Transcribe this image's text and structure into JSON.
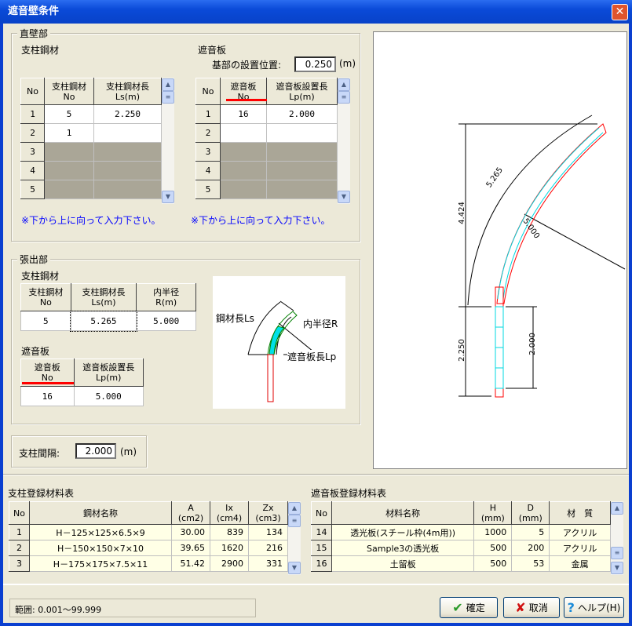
{
  "window": {
    "title": "遮音壁条件",
    "close": "✕"
  },
  "straight": {
    "legend": "直壁部",
    "post": {
      "label": "支柱鋼材",
      "headers": [
        "No",
        "支柱鋼材\nNo",
        "支柱鋼材長\nLs(m)"
      ],
      "rows": [
        [
          "1",
          "5",
          "2.250"
        ],
        [
          "2",
          "1",
          ""
        ],
        [
          "3",
          "",
          ""
        ],
        [
          "4",
          "",
          ""
        ],
        [
          "5",
          "",
          ""
        ]
      ]
    },
    "panel": {
      "label": "遮音板",
      "base_label": "基部の設置位置:",
      "base_value": "0.250",
      "base_unit": "(m)",
      "headers": [
        "No",
        "遮音板\nNo",
        "遮音板設置長\nLp(m)"
      ],
      "rows": [
        [
          "1",
          "16",
          "2.000"
        ],
        [
          "2",
          "",
          ""
        ],
        [
          "3",
          "",
          ""
        ],
        [
          "4",
          "",
          ""
        ],
        [
          "5",
          "",
          ""
        ]
      ]
    },
    "note": "※下から上に向って入力下さい。"
  },
  "overhang": {
    "legend": "張出部",
    "post": {
      "label": "支柱鋼材",
      "headers": [
        "支柱鋼材\nNo",
        "支柱鋼材長\nLs(m)",
        "内半径\nR(m)"
      ],
      "row": [
        "5",
        "5.265",
        "5.000"
      ]
    },
    "panel": {
      "label": "遮音板",
      "headers": [
        "遮音板\nNo",
        "遮音板設置長\nLp(m)"
      ],
      "row": [
        "16",
        "5.000"
      ]
    },
    "diagram": {
      "ls": "鋼材長Ls",
      "r": "内半径R",
      "lp": "遮音板長Lp"
    }
  },
  "spacing": {
    "label": "支柱間隔:",
    "value": "2.000",
    "unit": "(m)"
  },
  "drawing": {
    "arc_len": "5.265",
    "radius": "5.000",
    "height_top": "4.424",
    "height_bottom": "2.250",
    "panel_len": "2.000"
  },
  "post_table": {
    "label": "支柱登録材料表",
    "headers": [
      "No",
      "鋼材名称",
      "A\n(cm2)",
      "Ix\n(cm4)",
      "Zx\n(cm3)"
    ],
    "rows": [
      [
        "1",
        "H－125×125×6.5×9",
        "30.00",
        "839",
        "134"
      ],
      [
        "2",
        "H－150×150×7×10",
        "39.65",
        "1620",
        "216"
      ],
      [
        "3",
        "H－175×175×7.5×11",
        "51.42",
        "2900",
        "331"
      ]
    ]
  },
  "panel_table": {
    "label": "遮音板登録材料表",
    "headers": [
      "No",
      "材料名称",
      "H\n(mm)",
      "D\n(mm)",
      "材　質"
    ],
    "rows": [
      [
        "14",
        "透光板(スチール枠(4m用))",
        "1000",
        "5",
        "アクリル"
      ],
      [
        "15",
        "Sample3の透光板",
        "500",
        "200",
        "アクリル"
      ],
      [
        "16",
        "土留板",
        "500",
        "53",
        "金属"
      ]
    ]
  },
  "status": "範囲: 0.001～99.999",
  "buttons": {
    "ok": "確定",
    "cancel": "取消",
    "help": "ヘルプ(H)"
  },
  "colors": {
    "accent_red": "#ff0000",
    "panel_cyan": "#00ffff",
    "note_blue": "#0000ff"
  }
}
